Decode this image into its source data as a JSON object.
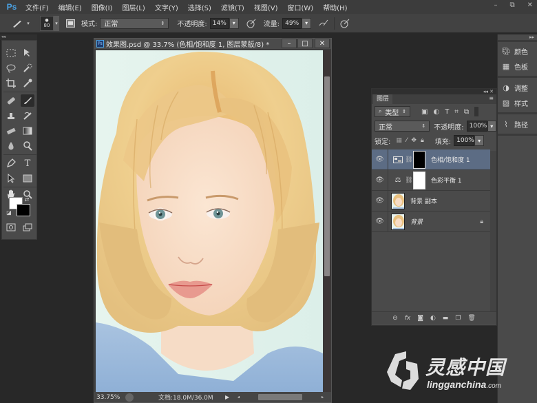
{
  "app": {
    "logo": "Ps",
    "menu": [
      "文件(F)",
      "编辑(E)",
      "图像(I)",
      "图层(L)",
      "文字(Y)",
      "选择(S)",
      "滤镜(T)",
      "视图(V)",
      "窗口(W)",
      "帮助(H)"
    ],
    "window_controls": {
      "minimize": "–",
      "restore": "⧉",
      "close": "✕"
    }
  },
  "options_bar": {
    "brush_size": "80",
    "mode_label": "模式:",
    "mode_value": "正常",
    "opacity_label": "不透明度:",
    "opacity_value": "14%",
    "flow_label": "流量:",
    "flow_value": "49%"
  },
  "tools": {
    "icons": [
      "marquee-icon",
      "move-icon",
      "lasso-icon",
      "quick-select-icon",
      "crop-icon",
      "eyedropper-icon",
      "healing-brush-icon",
      "brush-icon",
      "clone-stamp-icon",
      "history-brush-icon",
      "eraser-icon",
      "gradient-icon",
      "blur-icon",
      "dodge-icon",
      "pen-icon",
      "type-icon",
      "path-select-icon",
      "rectangle-icon",
      "hand-icon",
      "zoom-icon"
    ],
    "active": "brush-icon",
    "foreground_color": "#ffffff",
    "background_color": "#000000"
  },
  "document": {
    "icon": "Ps",
    "title": "效果图.psd @ 33.7% (色相/饱和度 1, 图层蒙版/8) *",
    "zoom": "33.75%",
    "doc_info": "文档:18.0M/36.0M",
    "v_scroll_position": 0.1,
    "h_scroll_position": 0.75
  },
  "layers_panel": {
    "tab": "图层",
    "filter_kind": "类型",
    "blend_mode": "正常",
    "opacity_label": "不透明度:",
    "opacity_value": "100%",
    "lock_label": "锁定:",
    "fill_label": "填充:",
    "fill_value": "100%",
    "layers": [
      {
        "name": "色相/饱和度 1",
        "type": "adjustment",
        "icon": "hue-saturation-icon",
        "mask": "#000000",
        "selected": true,
        "visible": true
      },
      {
        "name": "色彩平衡 1",
        "type": "adjustment",
        "icon": "color-balance-icon",
        "mask": "#ffffff",
        "selected": false,
        "visible": true
      },
      {
        "name": "背景 副本",
        "type": "pixel",
        "selected": false,
        "visible": true
      },
      {
        "name": "背景",
        "type": "background",
        "italic": true,
        "locked": true,
        "selected": false,
        "visible": true
      }
    ],
    "footer_icons": [
      "link-icon",
      "fx-icon",
      "add-mask-icon",
      "new-adjustment-icon",
      "new-group-icon",
      "new-layer-icon",
      "delete-icon"
    ]
  },
  "right_dock": {
    "items": [
      {
        "label": "颜色",
        "icon": "color-palette-icon"
      },
      {
        "label": "色板",
        "icon": "swatches-icon"
      },
      {
        "label": "调整",
        "icon": "adjustments-icon"
      },
      {
        "label": "样式",
        "icon": "styles-icon"
      },
      {
        "label": "路径",
        "icon": "paths-icon"
      }
    ]
  },
  "watermark": {
    "cn": "灵感中国",
    "en": "lingganchina",
    "domain": ".com"
  }
}
